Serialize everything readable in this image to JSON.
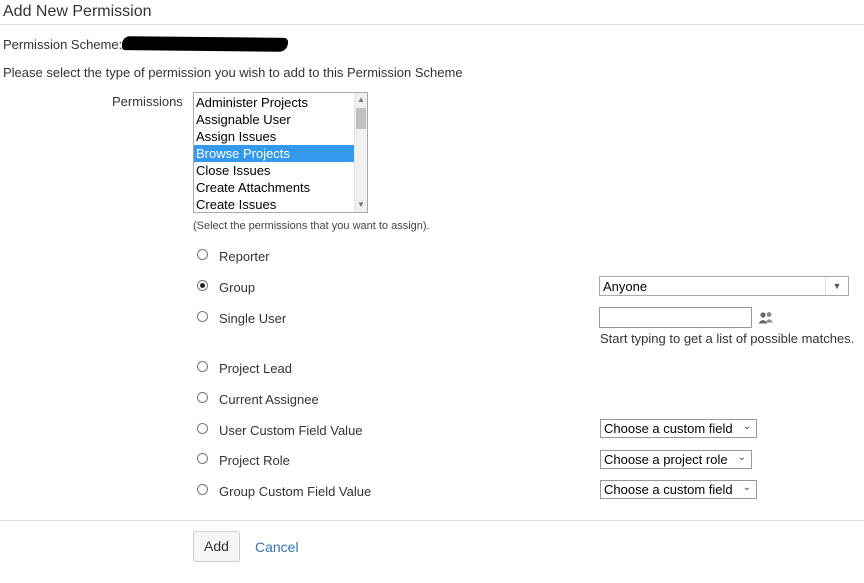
{
  "page": {
    "title": "Add New Permission",
    "scheme_label": "Permission Scheme:",
    "instructions": "Please select the type of permission you wish to add to this Permission Scheme"
  },
  "permissions": {
    "label": "Permissions",
    "options": [
      "Administer Projects",
      "Assignable User",
      "Assign Issues",
      "Browse Projects",
      "Close Issues",
      "Create Attachments",
      "Create Issues"
    ],
    "selected": "Browse Projects",
    "hint": "(Select the permissions that you want to assign)."
  },
  "types": {
    "reporter": "Reporter",
    "group": "Group",
    "single_user": "Single User",
    "project_lead": "Project Lead",
    "current_assignee": "Current Assignee",
    "user_custom_field": "User Custom Field Value",
    "project_role": "Project Role",
    "group_custom_field": "Group Custom Field Value",
    "checked": "group"
  },
  "controls": {
    "group_value": "Anyone",
    "single_user_value": "",
    "single_user_hint": "Start typing to get a list of possible matches.",
    "user_cf_value": "Choose a custom field",
    "project_role_value": "Choose a project role",
    "group_cf_value": "Choose a custom field"
  },
  "footer": {
    "add_label": "Add",
    "cancel_label": "Cancel"
  },
  "icons": {
    "user_picker": "user-picker-icon",
    "dropdown": "chevron-down-icon"
  },
  "colors": {
    "selection": "#3399ee",
    "link": "#3572b0"
  }
}
